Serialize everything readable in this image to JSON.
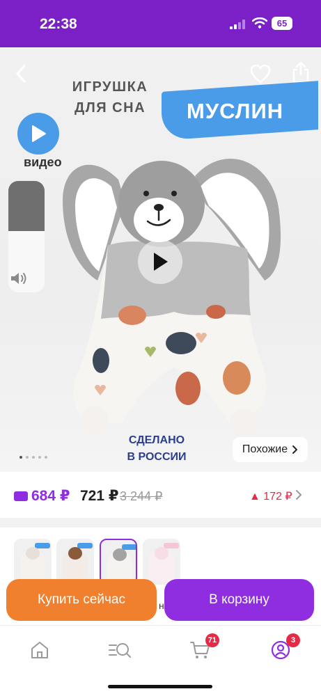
{
  "status": {
    "time": "22:38",
    "battery": "65"
  },
  "hero": {
    "title_lines": [
      "ИГРУШКА",
      "ДЛЯ СНА"
    ],
    "badge": "МУСЛИН",
    "video_label": "видео",
    "made_in_lines": [
      "СДЕЛАНО",
      "В РОССИИ"
    ],
    "similar_label": "Похожие",
    "volume_level": 0.45,
    "image_count": 5,
    "image_index": 0
  },
  "price": {
    "wallet_price": "684 ₽",
    "price": "721 ₽",
    "old_price": "3 244 ₽",
    "change": "▲ 172 ₽"
  },
  "actions": {
    "buy_now": "Купить сейчас",
    "add_to_cart": "В корзину",
    "peek_letter": "н"
  },
  "tabs": {
    "cart_badge": "71",
    "profile_badge": "3"
  },
  "colors": {
    "brand": "#7b1fc7",
    "accent": "#8e2ee0",
    "buy": "#f07f2e",
    "badge_blue": "#4a9be8",
    "alert": "#e52a45"
  }
}
